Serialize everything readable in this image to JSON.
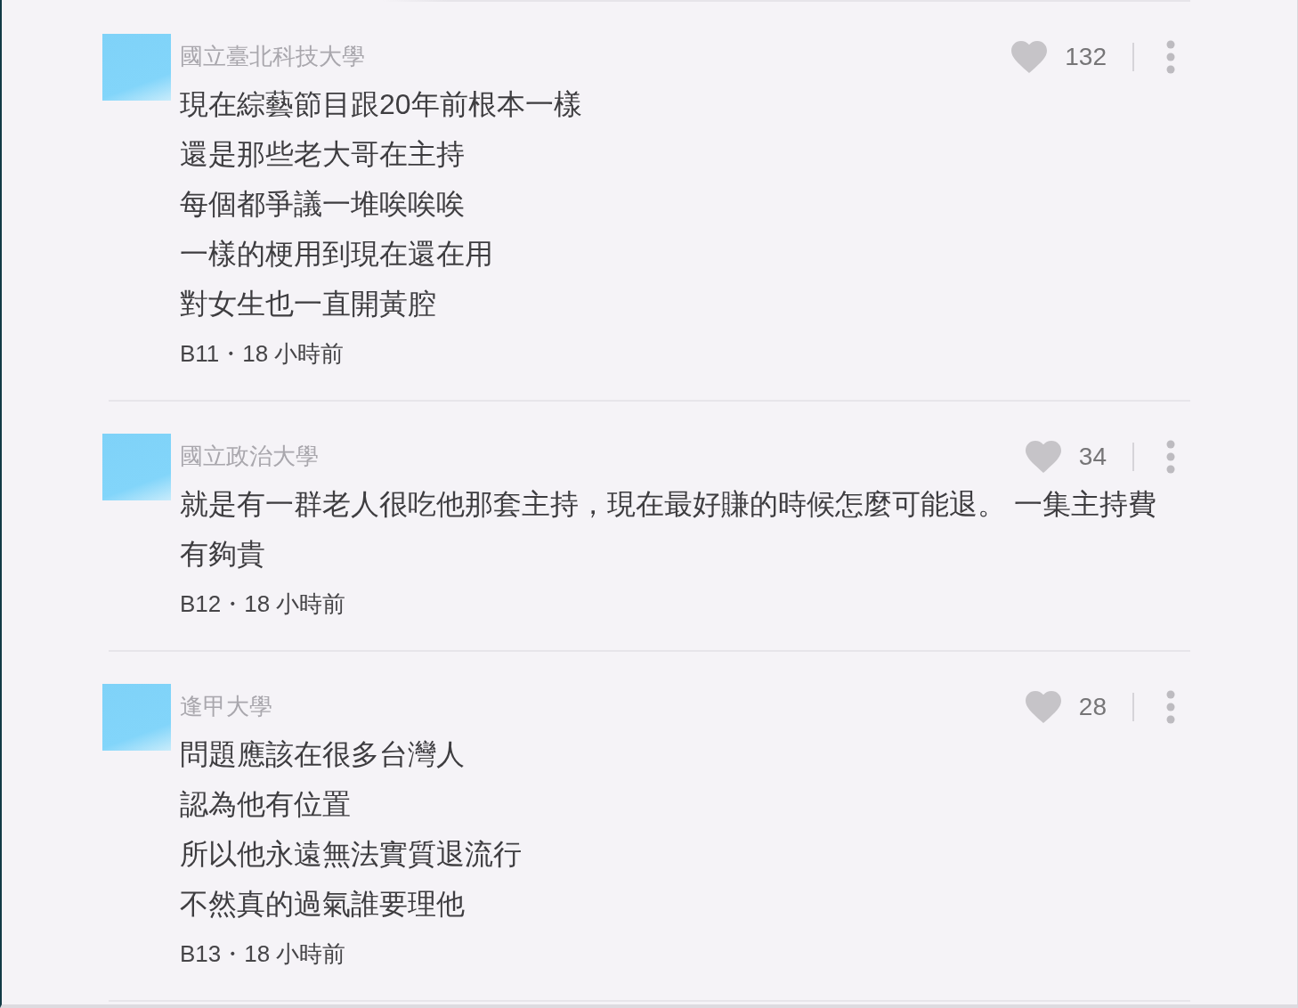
{
  "comments": [
    {
      "school": "國立臺北科技大學",
      "liked": false,
      "likes": "132",
      "text_lines": [
        "現在綜藝節目跟20年前根本一樣",
        "還是那些老大哥在主持",
        "每個都爭議一堆唉唉唉",
        "一樣的梗用到現在還在用",
        "對女生也一直開黃腔"
      ],
      "meta": "B11・18 小時前"
    },
    {
      "school": "國立政治大學",
      "liked": false,
      "likes": "34",
      "text_lines": [
        "就是有一群老人很吃他那套主持，現在最好賺的時候怎麼可能退。 一集主持費有夠貴"
      ],
      "meta": "B12・18 小時前"
    },
    {
      "school": "逢甲大學",
      "liked": false,
      "likes": "28",
      "text_lines": [
        "問題應該在很多台灣人",
        "認為他有位置",
        "所以他永遠無法實質退流行",
        "不然真的過氣誰要理他"
      ],
      "meta": "B13・18 小時前"
    }
  ]
}
